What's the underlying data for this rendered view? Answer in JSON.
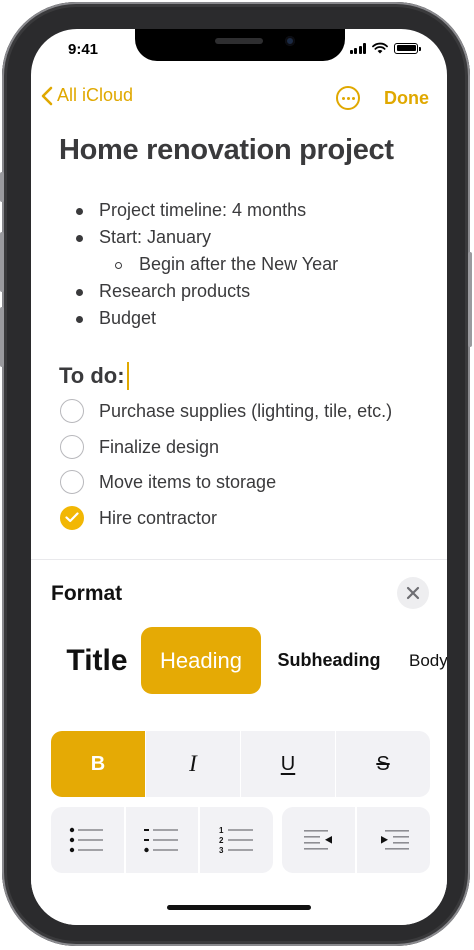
{
  "status_bar": {
    "time": "9:41"
  },
  "nav": {
    "back_label": "All iCloud",
    "done_label": "Done"
  },
  "note": {
    "title": "Home renovation project",
    "bullets": [
      {
        "text": "Project timeline: 4 months"
      },
      {
        "text": "Start: January"
      },
      {
        "text": "Begin after the New Year"
      },
      {
        "text": "Research products"
      },
      {
        "text": "Budget"
      }
    ],
    "todo_heading": "To do:",
    "checklist": [
      {
        "text": "Purchase supplies (lighting, tile, etc.)",
        "checked": false
      },
      {
        "text": "Finalize design",
        "checked": false
      },
      {
        "text": "Move items to storage",
        "checked": false
      },
      {
        "text": "Hire contractor",
        "checked": true
      }
    ]
  },
  "format_panel": {
    "title": "Format",
    "styles": {
      "title": "Title",
      "heading": "Heading",
      "subheading": "Subheading",
      "body": "Body"
    },
    "selected_style": "Heading",
    "text_styles": {
      "bold": "B",
      "italic": "I",
      "underline": "U",
      "strikethrough": "S"
    },
    "active_text_style": "bold"
  },
  "colors": {
    "accent": "#e0a800",
    "selected_fill": "#e5aa05",
    "check_fill": "#f2b704"
  },
  "icons": {
    "back": "chevron-left-icon",
    "more": "ellipsis-circle-icon",
    "close": "close-icon",
    "lists": [
      "bulleted-list-icon",
      "dashed-list-icon",
      "numbered-list-icon"
    ],
    "indent": [
      "outdent-icon",
      "indent-icon"
    ]
  }
}
